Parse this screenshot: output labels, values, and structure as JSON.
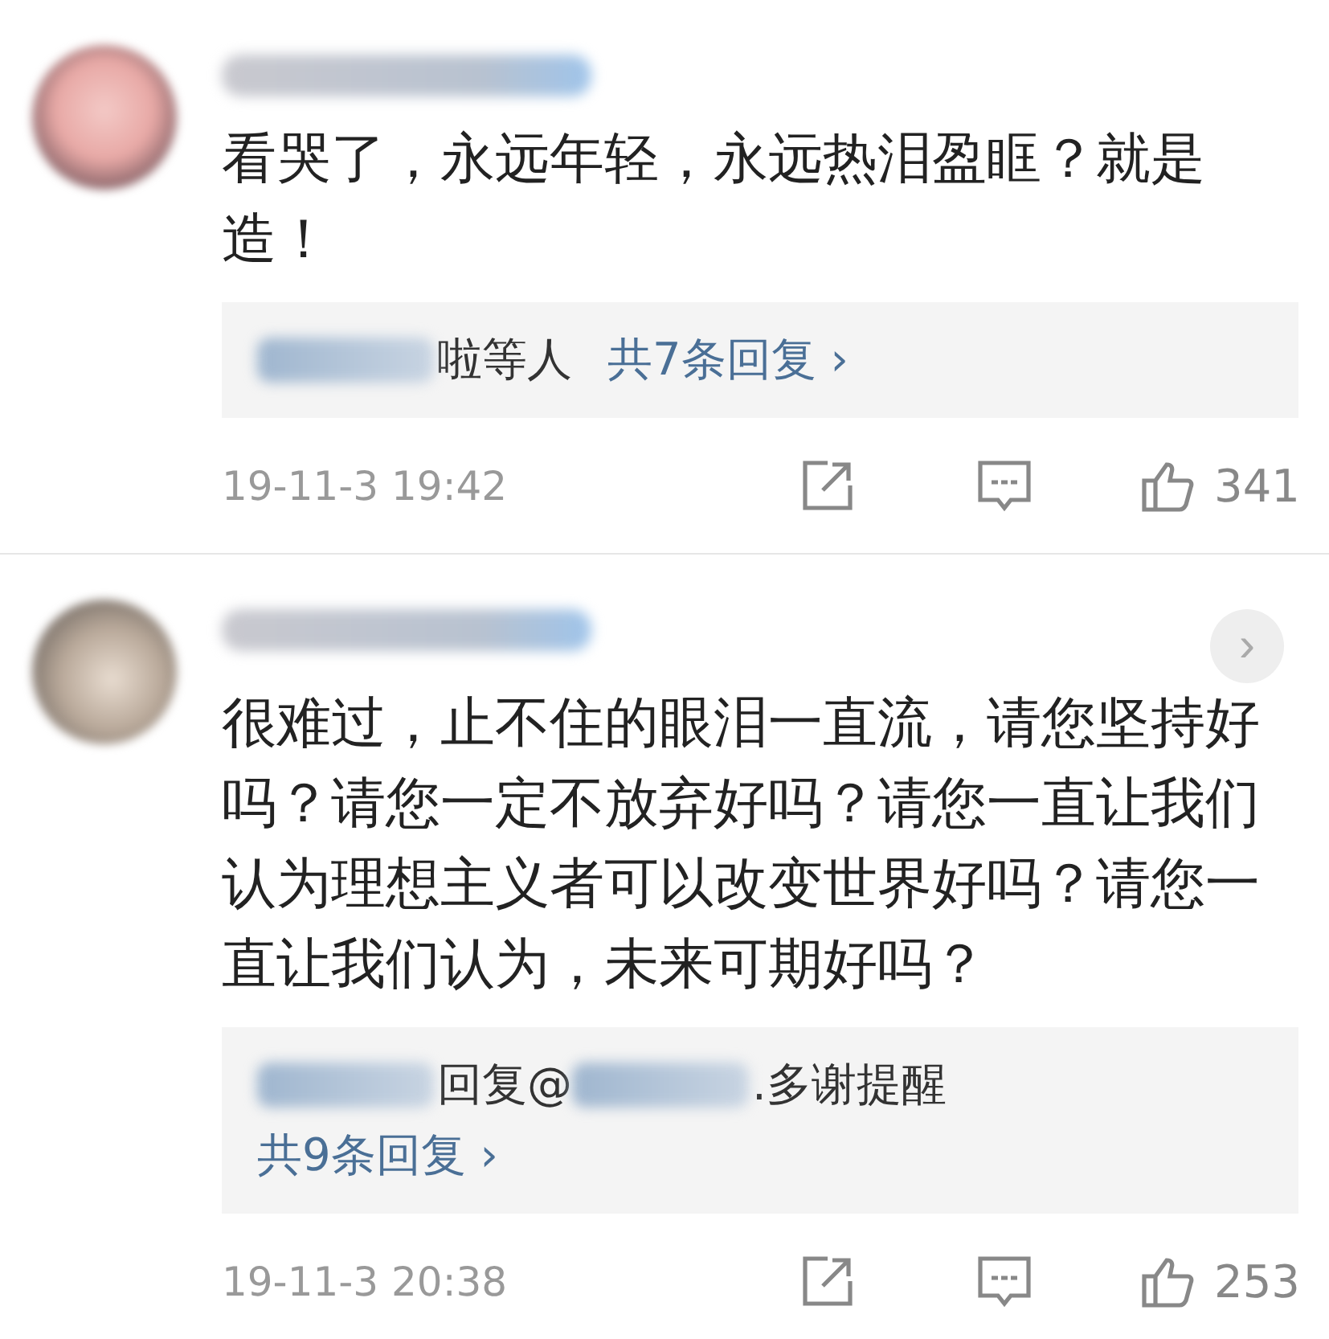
{
  "comments": [
    {
      "text": "看哭了，永远年轻，永远热泪盈眶？就是造！",
      "replies": {
        "parts": [
          {
            "kind": "smudge"
          },
          {
            "kind": "text",
            "text": "啦等人"
          }
        ],
        "count": "共7条回复",
        "chevron": "›"
      },
      "time": "19-11-3 19:42",
      "likes": "341"
    },
    {
      "text": "很难过，止不住的眼泪一直流，请您坚持好吗？请您一定不放弃好吗？请您一直让我们认为理想主义者可以改变世界好吗？请您一直让我们认为，未来可期好吗？",
      "replies": {
        "parts": [
          {
            "kind": "smudge"
          },
          {
            "kind": "text",
            "text": "回复@"
          },
          {
            "kind": "smudge"
          },
          {
            "kind": "text",
            "text": ".多谢提醒"
          }
        ],
        "count": "共9条回复",
        "chevron": "›"
      },
      "time": "19-11-3 20:38",
      "likes": "253",
      "next_button": "›"
    }
  ]
}
